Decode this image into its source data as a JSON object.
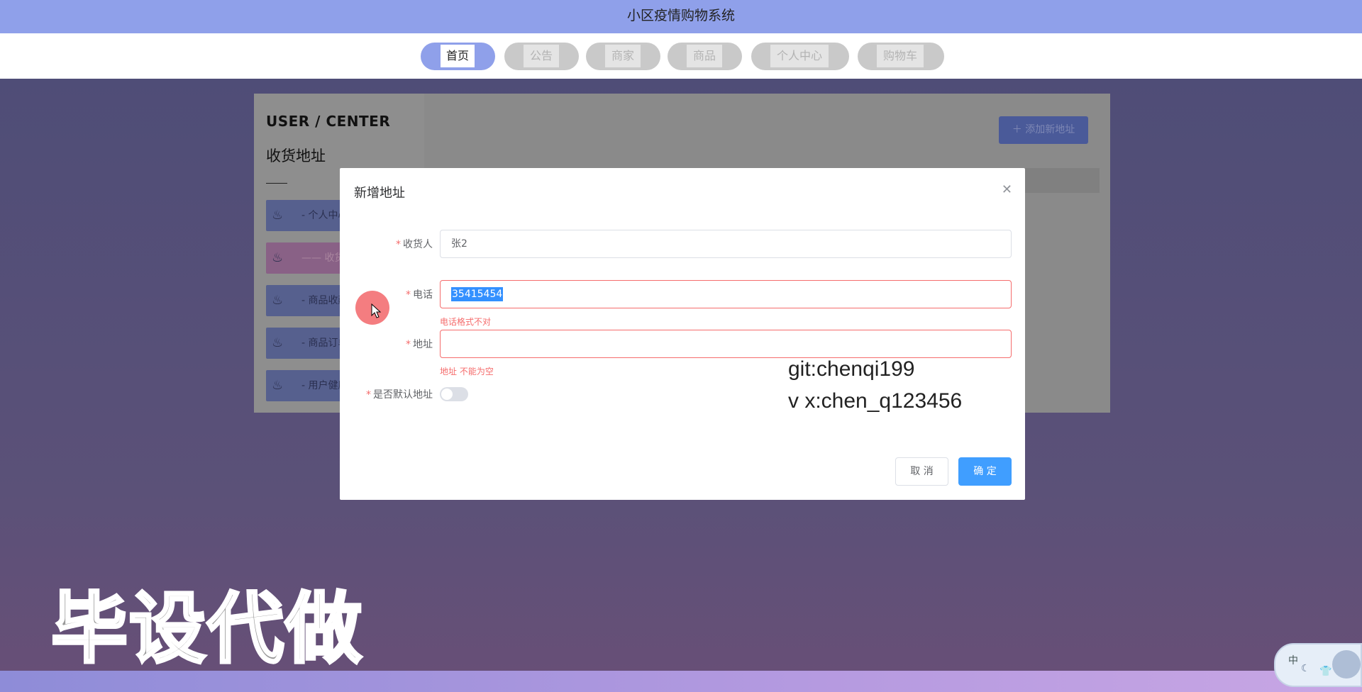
{
  "app": {
    "title": "小区疫情购物系统"
  },
  "nav": {
    "items": [
      {
        "label": "首页",
        "active": true
      },
      {
        "label": "公告",
        "active": false
      },
      {
        "label": "商家",
        "active": false
      },
      {
        "label": "商品",
        "active": false
      },
      {
        "label": "个人中心",
        "active": false
      },
      {
        "label": "购物车",
        "active": false
      }
    ]
  },
  "sidebar": {
    "heading": "USER / CENTER",
    "section": "收货地址",
    "items": [
      {
        "label": "个人中心",
        "prefix": "-"
      },
      {
        "label": "收货",
        "prefix": "——"
      },
      {
        "label": "商品收藏",
        "prefix": "-"
      },
      {
        "label": "商品订单",
        "prefix": "-"
      },
      {
        "label": "用户健康",
        "prefix": "-"
      }
    ]
  },
  "page": {
    "add_button": "添加新地址"
  },
  "modal": {
    "title": "新增地址",
    "fields": {
      "receiver": {
        "label": "收货人",
        "value": "张2"
      },
      "phone": {
        "label": "电话",
        "value": "35415454",
        "error": "电话格式不对"
      },
      "address": {
        "label": "地址",
        "value": "",
        "error": "地址 不能为空"
      },
      "default": {
        "label": "是否默认地址",
        "on": false
      }
    },
    "cancel": "取 消",
    "confirm": "确 定"
  },
  "overlay_text": {
    "git": "git:chenqi199",
    "vx": "v x:chen_q123456",
    "banner": "毕设代做"
  },
  "ime": {
    "mode": "中"
  },
  "colors": {
    "header": "#8fa0ea",
    "primary": "#409eff",
    "error": "#f56c6c"
  }
}
